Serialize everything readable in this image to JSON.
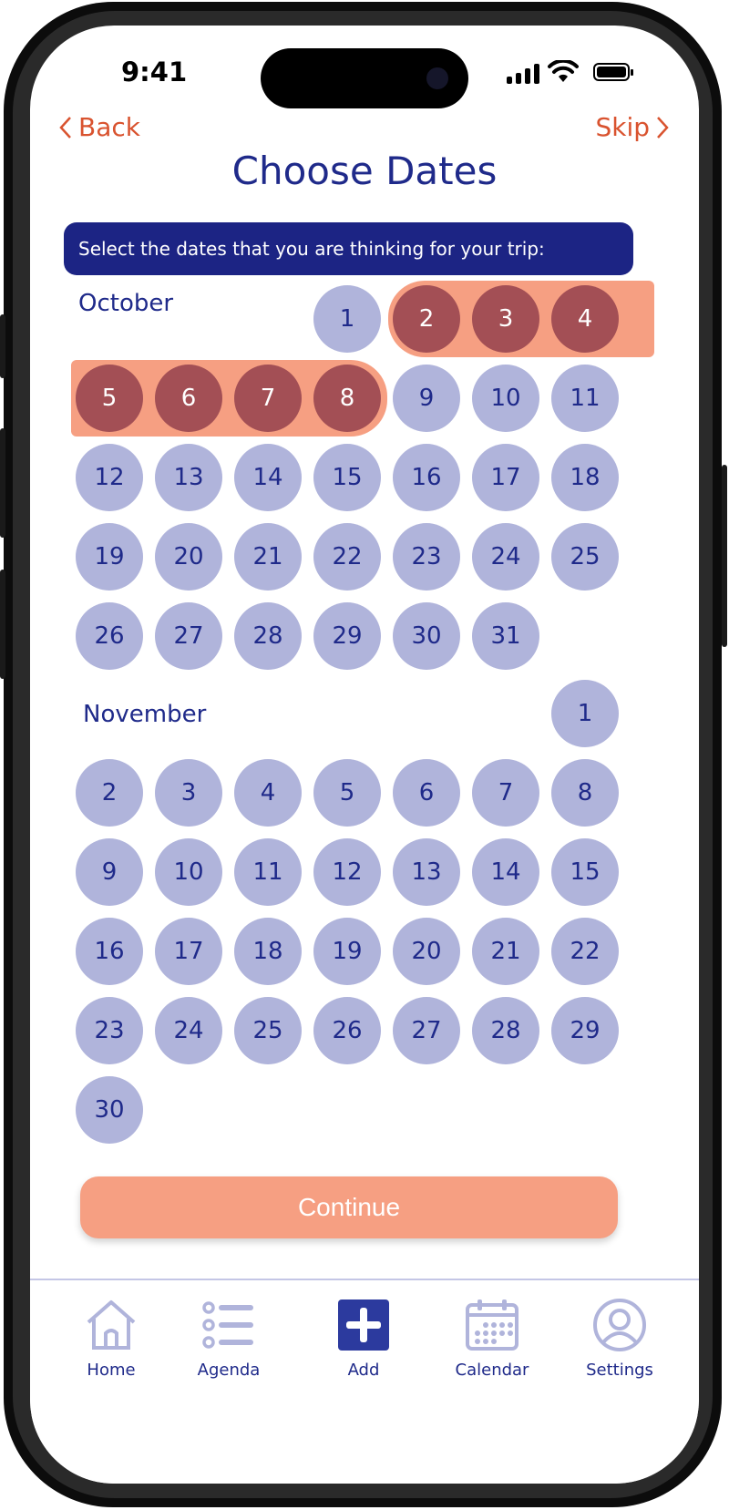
{
  "status_bar": {
    "time": "9:41"
  },
  "nav": {
    "back_label": "Back",
    "skip_label": "Skip"
  },
  "page": {
    "title": "Choose Dates",
    "instruction": "Select the dates that you are thinking for your trip:"
  },
  "calendar": {
    "months": [
      {
        "name": "October",
        "days": [
          "1",
          "2",
          "3",
          "4",
          "5",
          "6",
          "7",
          "8",
          "9",
          "10",
          "11",
          "12",
          "13",
          "14",
          "15",
          "16",
          "17",
          "18",
          "19",
          "20",
          "21",
          "22",
          "23",
          "24",
          "25",
          "26",
          "27",
          "28",
          "29",
          "30",
          "31"
        ],
        "selected": [
          "2",
          "3",
          "4",
          "5",
          "6",
          "7",
          "8"
        ]
      },
      {
        "name": "November",
        "days": [
          "1",
          "2",
          "3",
          "4",
          "5",
          "6",
          "7",
          "8",
          "9",
          "10",
          "11",
          "12",
          "13",
          "14",
          "15",
          "16",
          "17",
          "18",
          "19",
          "20",
          "21",
          "22",
          "23",
          "24",
          "25",
          "26",
          "27",
          "28",
          "29",
          "30"
        ],
        "selected": []
      }
    ]
  },
  "actions": {
    "continue_label": "Continue"
  },
  "tab_bar": {
    "items": [
      {
        "label": "Home",
        "icon": "home-icon"
      },
      {
        "label": "Agenda",
        "icon": "agenda-icon"
      },
      {
        "label": "Add",
        "icon": "add-icon"
      },
      {
        "label": "Calendar",
        "icon": "calendar-icon"
      },
      {
        "label": "Settings",
        "icon": "settings-icon"
      }
    ]
  },
  "colors": {
    "accent_orange": "#f69f82",
    "selected_day": "#a34f55",
    "unselected_day": "#b0b4db",
    "navy": "#1c2484",
    "link": "#d9532f"
  }
}
